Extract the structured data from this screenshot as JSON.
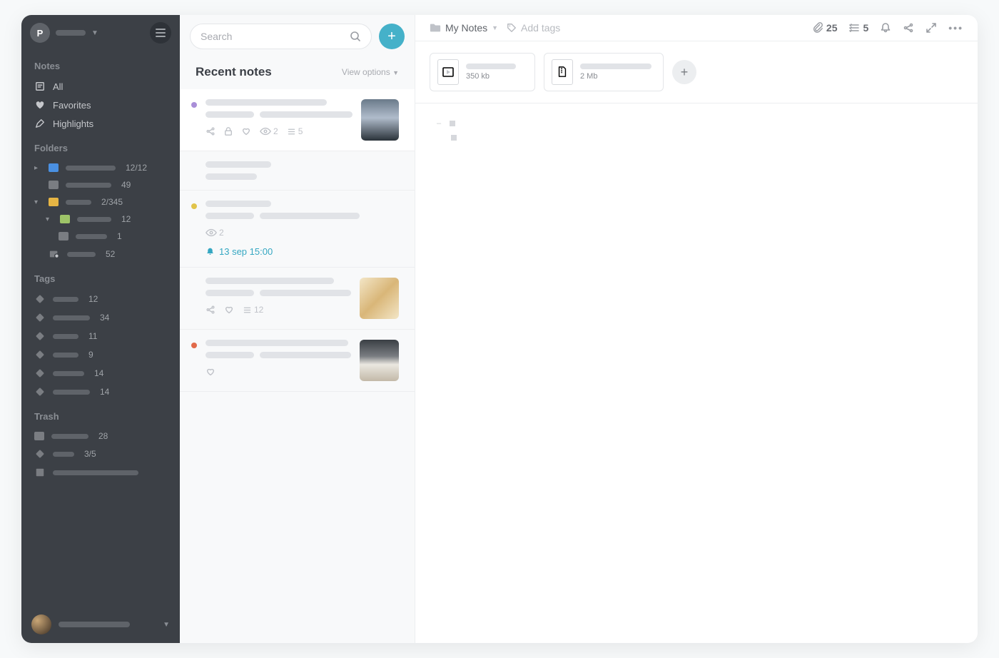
{
  "sidebar": {
    "avatar_letter": "P",
    "sections": {
      "notes_title": "Notes",
      "notes_items": {
        "all": "All",
        "favorites": "Favorites",
        "highlights": "Highlights"
      },
      "folders_title": "Folders",
      "folders": [
        {
          "count": "12/12"
        },
        {
          "count": "49"
        },
        {
          "count": "2/345"
        },
        {
          "count": "12"
        },
        {
          "count": "1"
        },
        {
          "count": "52"
        }
      ],
      "tags_title": "Tags",
      "tags": [
        {
          "count": "12"
        },
        {
          "count": "34"
        },
        {
          "count": "11"
        },
        {
          "count": "9"
        },
        {
          "count": "14"
        },
        {
          "count": "14"
        }
      ],
      "trash_title": "Trash",
      "trash": [
        {
          "count": "28"
        },
        {
          "count": "3/5"
        },
        {
          "count": ""
        }
      ]
    }
  },
  "middle": {
    "search_placeholder": "Search",
    "title": "Recent notes",
    "view_options": "View options",
    "notes": [
      {
        "views": "2",
        "items": "5"
      },
      {},
      {
        "views": "2",
        "reminder": "13 sep 15:00"
      },
      {
        "items": "12"
      },
      {}
    ]
  },
  "right": {
    "breadcrumb": "My Notes",
    "add_tags": "Add tags",
    "toolbar": {
      "attachments_count": "25",
      "todos_count": "5"
    },
    "attachments": [
      {
        "size": "350 kb"
      },
      {
        "size": "2 Mb"
      }
    ]
  }
}
